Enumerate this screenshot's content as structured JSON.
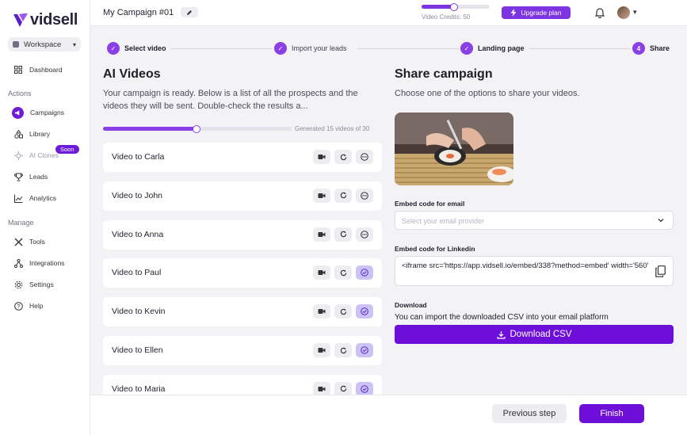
{
  "app": {
    "name": "vidsell"
  },
  "sidebar": {
    "workspace": "Workspace",
    "dashboard": "Dashboard",
    "actions_heading": "Actions",
    "manage_heading": "Manage",
    "items": [
      {
        "label": "Campaigns",
        "icon": "megaphone-icon",
        "active": true
      },
      {
        "label": "Library",
        "icon": "shapes-icon"
      },
      {
        "label": "AI Clones",
        "icon": "sparkle-icon",
        "badge": "Soon",
        "disabled": true
      },
      {
        "label": "Leads",
        "icon": "trophy-icon"
      },
      {
        "label": "Analytics",
        "icon": "chart-line-icon"
      }
    ],
    "manage_items": [
      {
        "label": "Tools",
        "icon": "tools-icon"
      },
      {
        "label": "Integrations",
        "icon": "integrations-icon"
      },
      {
        "label": "Settings",
        "icon": "gear-icon"
      },
      {
        "label": "Help",
        "icon": "help-icon"
      }
    ]
  },
  "header": {
    "campaign_title": "My Campaign #01",
    "credits_label": "Video Credits: 50",
    "credits_fraction": 0.5,
    "upgrade_label": "Upgrade plan"
  },
  "stepper": {
    "steps": [
      {
        "label": "Select video",
        "state": "done"
      },
      {
        "label": "Import your leads",
        "state": "done"
      },
      {
        "label": "Landing page",
        "state": "done"
      },
      {
        "label": "Share",
        "number": "4",
        "state": "current"
      }
    ]
  },
  "videos": {
    "title": "AI Videos",
    "description": "Your campaign is ready. Below is a list of all the prospects and the videos they will be sent. Double-check the results a...",
    "generated_label": "Generated 15 videos of 30",
    "generated_fraction": 0.5,
    "rows": [
      {
        "name": "Video to Carla",
        "approved": false
      },
      {
        "name": "Video to John",
        "approved": false
      },
      {
        "name": "Video to Anna",
        "approved": false
      },
      {
        "name": "Video to Paul",
        "approved": true
      },
      {
        "name": "Video to Kevin",
        "approved": true
      },
      {
        "name": "Video to Ellen",
        "approved": true
      },
      {
        "name": "Video to Maria",
        "approved": true
      }
    ]
  },
  "share": {
    "title": "Share campaign",
    "subtitle": "Choose one of the options to share your videos.",
    "email_label": "Embed code for email",
    "email_placeholder": "Select your email provider",
    "linkedin_label": "Embed code for Linkedin",
    "linkedin_code": "<iframe src='https://app.vidsell.io/embed/338?method=embed' width='560'",
    "download_label": "Download",
    "download_text": "You can import the downloaded CSV into your email platform",
    "download_button": "Download CSV"
  },
  "footer": {
    "previous": "Previous step",
    "finish": "Finish"
  },
  "colors": {
    "accent": "#6e0fd9",
    "accent_light": "#8a40e6"
  }
}
